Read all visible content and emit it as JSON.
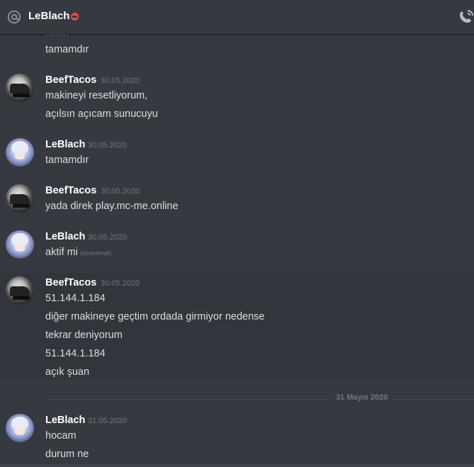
{
  "header": {
    "channel_name": "LeBlach",
    "at_icon": "at-icon",
    "status_icon": "do-not-disturb-icon",
    "call_icon": "call-icon"
  },
  "messages": {
    "cut_text": "hhhh",
    "line_tamamdir_top": "tamamdır",
    "group1": {
      "author": "BeefTacos",
      "timestamp": "30.05.2020",
      "lines": [
        "makineyi resetliyorum,",
        "açılsın açıcam sunucuyu"
      ]
    },
    "group2": {
      "author": "LeBlach",
      "timestamp": "30.05.2020",
      "lines": [
        "tamamdır"
      ]
    },
    "group3": {
      "author": "BeefTacos",
      "timestamp": "30.05.2020",
      "lines": [
        "yada direk play.mc-me.online"
      ]
    },
    "group4": {
      "author": "LeBlach",
      "timestamp": "30.05.2020",
      "lines": [
        "aktif mi"
      ],
      "edited": "(düzenlendi)"
    },
    "group5": {
      "author": "BeefTacos",
      "timestamp": "30.05.2020",
      "lines": [
        "51.144.1.184",
        "diğer makineye geçtim ordada girmiyor nedense",
        "tekrar deniyorum",
        "51.144.1.184",
        "açık şuan"
      ]
    },
    "date_divider": "31 Mayıs 2020",
    "group6": {
      "author": "LeBlach",
      "timestamp": "31.05.2020",
      "lines": [
        "hocam",
        "durum ne"
      ]
    }
  }
}
